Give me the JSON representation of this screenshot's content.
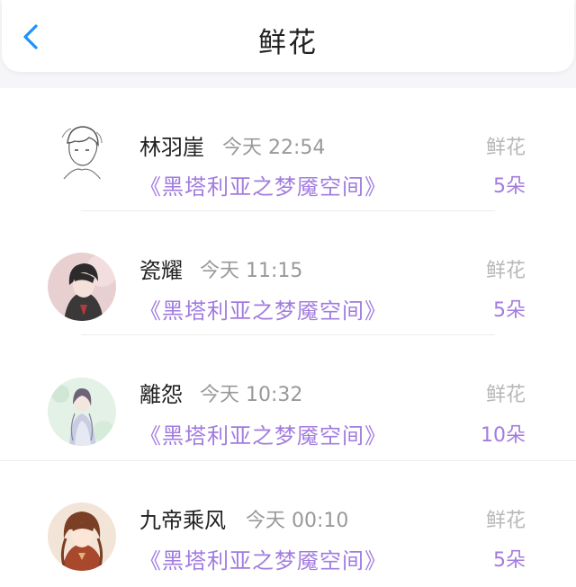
{
  "header": {
    "title": "鲜花",
    "back_icon": "chevron-left-icon",
    "accent": "#1e90ff"
  },
  "colors": {
    "book_title": "#a27cdf",
    "count": "#a27cdf",
    "muted": "#999999"
  },
  "records": [
    {
      "name": "林羽崖",
      "time": "今天 22:54",
      "book": "《黑塔利亚之梦魇空间》",
      "gift": "鲜花",
      "count": "5朵"
    },
    {
      "name": "瓷耀",
      "time": "今天 11:15",
      "book": "《黑塔利亚之梦魇空间》",
      "gift": "鲜花",
      "count": "5朵"
    },
    {
      "name": "離怨",
      "time": "今天 10:32",
      "book": "《黑塔利亚之梦魇空间》",
      "gift": "鲜花",
      "count": "10朵"
    },
    {
      "name": "九帝乘风",
      "time": "今天 00:10",
      "book": "《黑塔利亚之梦魇空间》",
      "gift": "鲜花",
      "count": "5朵"
    }
  ]
}
